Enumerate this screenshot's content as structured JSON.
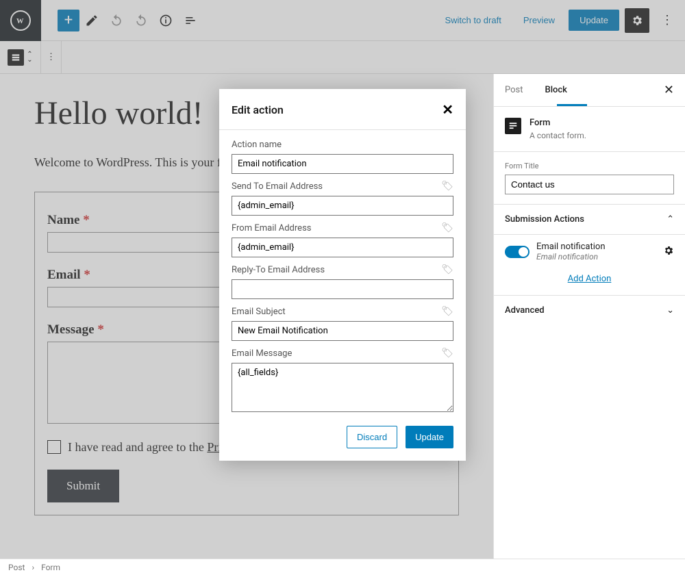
{
  "toolbar": {
    "switch_draft": "Switch to draft",
    "preview": "Preview",
    "update": "Update"
  },
  "canvas": {
    "heading": "Hello world!",
    "intro": "Welcome to WordPress. This is your first post. Edit or delete it, then start writing!",
    "form": {
      "name_label": "Name ",
      "email_label": "Email ",
      "message_label": "Message ",
      "consent_prefix": "I have read and agree to the ",
      "consent_link": "Privacy Policy",
      "consent_suffix": ". ",
      "submit": "Submit",
      "required": "*"
    }
  },
  "sidebar": {
    "tab_post": "Post",
    "tab_block": "Block",
    "block_name": "Form",
    "block_desc": "A contact form.",
    "form_title_label": "Form Title",
    "form_title_value": "Contact us",
    "section_submission": "Submission Actions",
    "action": {
      "name": "Email notification",
      "sub": "Email notification"
    },
    "add_action": "Add Action",
    "section_advanced": "Advanced"
  },
  "modal": {
    "title": "Edit action",
    "fields": {
      "action_name_label": "Action name",
      "action_name_value": "Email notification",
      "send_to_label": "Send To Email Address",
      "send_to_value": "{admin_email}",
      "from_label": "From Email Address",
      "from_value": "{admin_email}",
      "reply_to_label": "Reply-To Email Address",
      "reply_to_value": "",
      "subject_label": "Email Subject",
      "subject_value": "New Email Notification",
      "message_label": "Email Message",
      "message_value": "{all_fields}"
    },
    "discard": "Discard",
    "update": "Update"
  },
  "breadcrumb": {
    "post": "Post",
    "sep": "›",
    "form": "Form"
  }
}
